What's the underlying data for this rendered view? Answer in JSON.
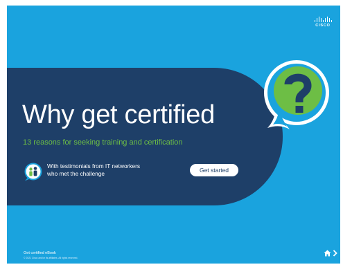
{
  "brand": {
    "logo_text": "CISCO"
  },
  "hero": {
    "title": "Why get certified",
    "subtitle": "13 reasons for seeking training and certification"
  },
  "testimonial": {
    "line1": "With testimonials from IT networkers",
    "line2": "who met the challenge"
  },
  "cta": {
    "label": "Get started"
  },
  "footer": {
    "title": "Get certified eBook",
    "copyright": "© 2021 Cisco and/or its affiliates. All rights reserved."
  },
  "icons": {
    "question_bubble": "question-mark-speech-bubble",
    "testimonial": "people-chat-bubble",
    "home": "home-icon",
    "next": "chevron-right-icon"
  },
  "colors": {
    "background": "#1aa3de",
    "banner": "#1e3f68",
    "accent_green": "#6dbe45",
    "white": "#ffffff"
  }
}
